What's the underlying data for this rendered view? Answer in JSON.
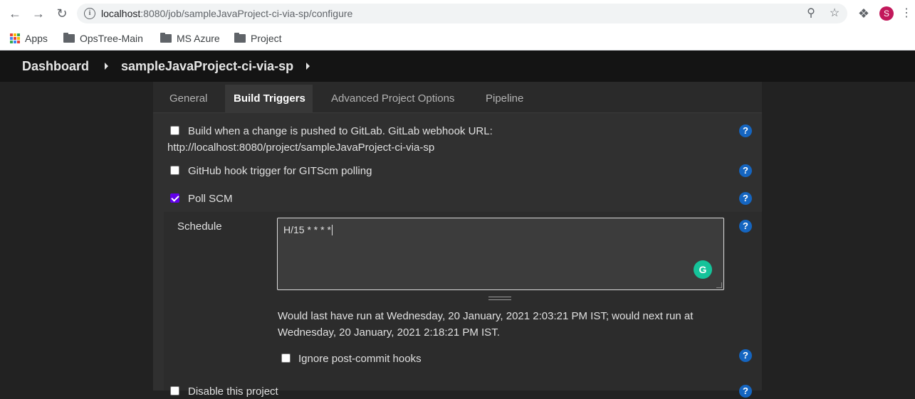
{
  "browser": {
    "url_host": "localhost",
    "url_rest": ":8080/job/sampleJavaProject-ci-via-sp/configure",
    "profile_initial": "S",
    "bookmarks": [
      {
        "label": "Apps",
        "icon": "apps-grid-icon"
      },
      {
        "label": "OpsTree-Main",
        "icon": "folder-icon"
      },
      {
        "label": "MS Azure",
        "icon": "folder-icon"
      },
      {
        "label": "Project",
        "icon": "folder-icon"
      }
    ]
  },
  "header": {
    "breadcrumbs": [
      "Dashboard",
      "sampleJavaProject-ci-via-sp"
    ]
  },
  "tabs": [
    "General",
    "Build Triggers",
    "Advanced Project Options",
    "Pipeline"
  ],
  "active_tab": "Build Triggers",
  "triggers": {
    "gitlab": {
      "label": "Build when a change is pushed to GitLab. GitLab webhook URL:",
      "url": "http://localhost:8080/project/sampleJavaProject-ci-via-sp",
      "checked": false
    },
    "github": {
      "label": "GitHub hook trigger for GITScm polling",
      "checked": false
    },
    "poll_scm": {
      "label": "Poll SCM",
      "checked": true
    },
    "schedule": {
      "label": "Schedule",
      "value": "H/15 * * * *",
      "info_line1": "Would last have run at Wednesday, 20 January, 2021 2:03:21 PM IST; would next run at",
      "info_line2": "Wednesday, 20 January, 2021 2:18:21 PM IST."
    },
    "ignore_post_commit": {
      "label": "Ignore post-commit hooks",
      "checked": false
    },
    "disable_project": {
      "label": "Disable this project",
      "checked": false
    }
  },
  "colors": {
    "help_icon": "#1565c0",
    "checkbox_checked": "#6200ea",
    "grammarly": "#15c39a",
    "header_bg": "#141414"
  }
}
